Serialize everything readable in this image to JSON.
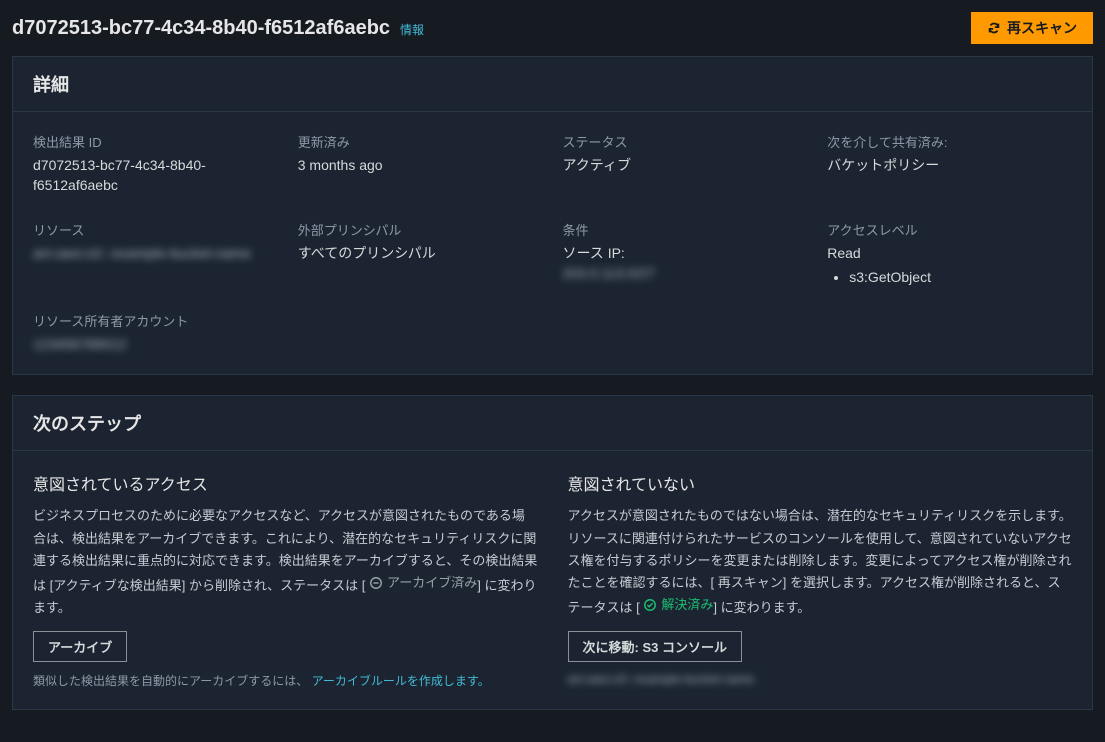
{
  "header": {
    "title": "d7072513-bc77-4c34-8b40-f6512af6aebc",
    "info_label": "情報",
    "rescan_label": "再スキャン"
  },
  "details": {
    "panel_title": "詳細",
    "fields": {
      "finding_id": {
        "label": "検出結果 ID",
        "value": "d7072513-bc77-4c34-8b40-f6512af6aebc"
      },
      "updated": {
        "label": "更新済み",
        "value": "3 months ago"
      },
      "status": {
        "label": "ステータス",
        "value": "アクティブ"
      },
      "shared_through": {
        "label": "次を介して共有済み:",
        "value": "バケットポリシー"
      },
      "resource": {
        "label": "リソース",
        "value": "arn:aws:s3:::example-bucket-name"
      },
      "external_principal": {
        "label": "外部プリンシパル",
        "value": "すべてのプリンシパル"
      },
      "condition": {
        "label": "条件",
        "source_ip_label": "ソース IP:",
        "source_ip_value": "203.0.113.0/27"
      },
      "access_level": {
        "label": "アクセスレベル",
        "value": "Read",
        "actions": [
          "s3:GetObject"
        ]
      },
      "resource_owner": {
        "label": "リソース所有者アカウント",
        "value": "123456789012"
      }
    }
  },
  "next_steps": {
    "panel_title": "次のステップ",
    "intended": {
      "title": "意図されているアクセス",
      "text_before": "ビジネスプロセスのために必要なアクセスなど、アクセスが意図されたものである場合は、検出結果をアーカイブできます。これにより、潜在的なセキュリティリスクに関連する検出結果に重点的に対応できます。検出結果をアーカイブすると、その検出結果は [アクティブな検出結果] から削除され、ステータスは [",
      "pill": "アーカイブ済み",
      "text_after": "] に変わります。",
      "archive_button": "アーカイブ",
      "note_prefix": "類似した検出結果を自動的にアーカイブするには、",
      "note_link": "アーカイブルールを作成します。"
    },
    "not_intended": {
      "title": "意図されていない",
      "text_before": "アクセスが意図されたものではない場合は、潜在的なセキュリティリスクを示します。リソースに関連付けられたサービスのコンソールを使用して、意図されていないアクセス権を付与するポリシーを変更または削除します。変更によってアクセス権が削除されたことを確認するには、[ 再スキャン] を選択します。アクセス権が削除されると、ステータスは [",
      "pill": "解決済み",
      "text_after": "] に変わります。",
      "goto_button": "次に移動: S3 コンソール",
      "resource_line": "arn:aws:s3:::example-bucket-name"
    }
  }
}
